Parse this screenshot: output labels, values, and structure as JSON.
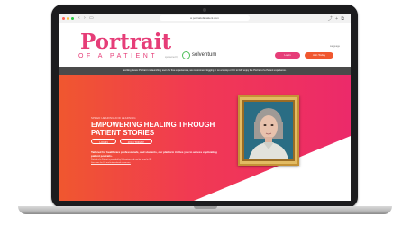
{
  "browser": {
    "url": "● portraitofapatient.com"
  },
  "header": {
    "logo_title": "Portrait",
    "logo_subtitle": "OF A PATIENT",
    "sponsor_text": "sponsored by",
    "sponsor_name": "solventum",
    "language": "Language",
    "login_label": "Login",
    "join_label": "Join Today"
  },
  "banner": {
    "text": "Exciting News: Portrait 1 is launching soon for free experiences, we recommend logging in on a laptop or PC to fully enjoy the Portrait of a Patient experience."
  },
  "hero": {
    "kicker": "SPEED HEARING AND LEARNING",
    "title": "EMPOWERING HEALING THROUGH PATIENT STORIES",
    "login_label": "LOGIN",
    "join_label": "JOIN TODAY!",
    "description": "Tailored for healthcare professionals, and students, our platform invites you to access captivating patient portraits.",
    "small_note": "Portrait of a Patient is provided by Solventum and can be found in 3M",
    "small_link": "See more for US and international resources."
  },
  "colors": {
    "brand_pink": "#e63d78",
    "hero_orange": "#f0572f",
    "hero_pink": "#ec2a6a",
    "frame_gold": "#c89a3c",
    "sponsor_green": "#4fbf5a",
    "banner_gray": "#4a4a4a"
  }
}
